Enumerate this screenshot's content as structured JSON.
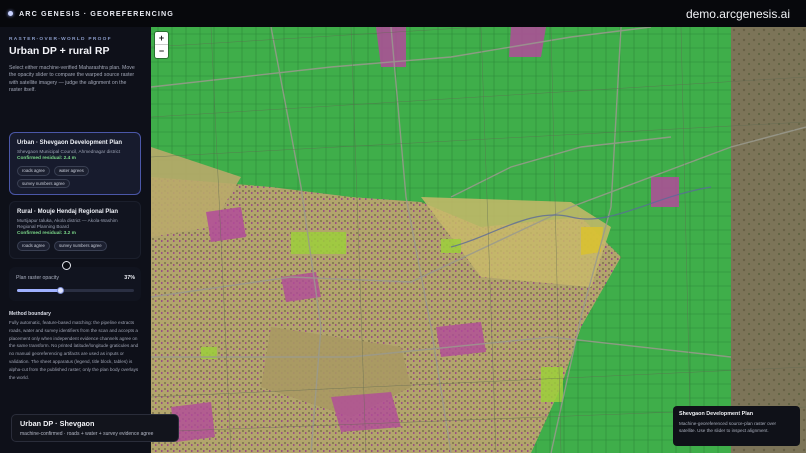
{
  "header": {
    "brand": "ARC GENESIS · GEOREFERENCING",
    "domain": "demo.arcgenesis.ai"
  },
  "sidebar": {
    "eyebrow": "RASTER-OVER-WORLD PROOF",
    "title": "Urban DP + rural RP",
    "intro": "Select either machine-verified Maharashtra plan. Move the opacity slider to compare the warped source raster with satellite imagery — judge the alignment on the raster itself.",
    "plans": [
      {
        "title": "Urban · Shevgaon Development Plan",
        "subtitle": "Shevgaon Municipal Council, Ahmednagar district",
        "residual": "Confirmed residual: 2.4 m",
        "chips": [
          "roads agree",
          "water agrees",
          "survey numbers agree"
        ],
        "active": true
      },
      {
        "title": "Rural · Mouje Hendaj Regional Plan",
        "subtitle": "Murtijapur taluka, Akola district — Akola-Washim Regional Planning Board",
        "residual": "Confirmed residual: 3.2 m",
        "chips": [
          "roads agree",
          "survey numbers agree"
        ],
        "active": false
      }
    ],
    "opacity": {
      "label": "Plan raster opacity",
      "value_text": "37%",
      "value": 0.37
    },
    "method": {
      "title": "Method boundary",
      "text": "Fully automatic, feature-based matching: the pipeline extracts roads, water and survey identifiers from the scan and accepts a placement only when independent evidence channels agree on the same transform. No printed latitude/longitude graticules and no manual georeferencing artifacts are used as inputs or validation. The sheet apparatus (legend, title block, tables) is alpha-cut from the published raster; only the plan body overlays the world."
    }
  },
  "map": {
    "zoom_in": "+",
    "zoom_out": "−",
    "selected_card": {
      "title": "Urban DP · Shevgaon",
      "subtitle": "machine-confirmed · roads + water + survey evidence agree"
    },
    "info_card": {
      "title": "Shevgaon Development Plan",
      "text": "Machine-georeferenced source-plan raster over satellite. Use the slider to inspect alignment."
    },
    "colors": {
      "agriculture_green": "#3fae4a",
      "residential_yellow": "#c9b35a",
      "commercial_magenta": "#b24b9a",
      "road_grey": "#9a9a8e",
      "satellite_ground": "#6f6850"
    }
  }
}
